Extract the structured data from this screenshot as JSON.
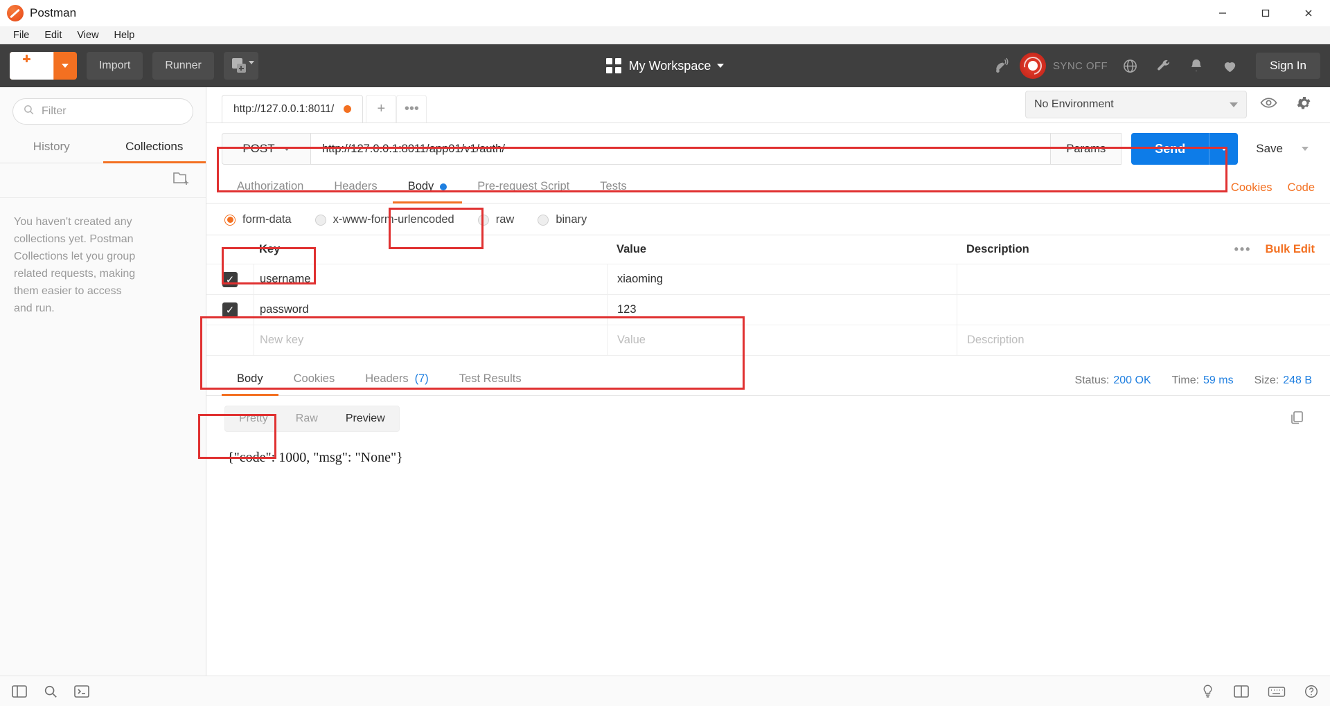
{
  "window": {
    "title": "Postman",
    "logo_icon": "postman-logo-icon",
    "minimize": "—",
    "maximize": "❐",
    "close": "✕"
  },
  "menubar": {
    "items": [
      "File",
      "Edit",
      "View",
      "Help"
    ]
  },
  "header": {
    "new_button": "New",
    "import_button": "Import",
    "runner_button": "Runner",
    "new_window_icon": "new-window-icon",
    "workspace_label": "My Workspace",
    "workspace_icon": "grid-icon",
    "antenna_icon": "satellite-antenna-icon",
    "sync_label": "SYNC OFF",
    "sync_icon": "sync-status-icon",
    "globe_icon": "globe-icon",
    "wrench_icon": "wrench-icon",
    "bell_icon": "bell-icon",
    "heart_icon": "heart-icon",
    "sign_in": "Sign In"
  },
  "sidebar": {
    "filter_placeholder": "Filter",
    "search_icon": "search-icon",
    "tabs": [
      {
        "label": "History",
        "active": false
      },
      {
        "label": "Collections",
        "active": true
      }
    ],
    "new_folder_icon": "new-folder-icon",
    "empty_message": "You haven't created any collections yet. Postman Collections let you group related requests, making them easier to access and run."
  },
  "request_tabs": {
    "open_tab_label": "http://127.0.0.1:8011/",
    "unsaved_indicator": "unsaved-dot",
    "new_tab_icon": "+",
    "more_icon": "•••"
  },
  "environment": {
    "selected": "No Environment",
    "eye_icon": "eye-icon",
    "settings_icon": "gear-icon"
  },
  "url_bar": {
    "method": "POST",
    "url": "http://127.0.0.1:8011/app01/v1/auth/",
    "params_button": "Params",
    "send_button": "Send",
    "save_button": "Save"
  },
  "request_sections": {
    "tabs": [
      {
        "label": "Authorization",
        "active": false,
        "dot": false
      },
      {
        "label": "Headers",
        "active": false,
        "dot": false
      },
      {
        "label": "Body",
        "active": true,
        "dot": true
      },
      {
        "label": "Pre-request Script",
        "active": false,
        "dot": false
      },
      {
        "label": "Tests",
        "active": false,
        "dot": false
      }
    ],
    "cookies_link": "Cookies",
    "code_link": "Code"
  },
  "body_type": {
    "options": [
      {
        "label": "form-data",
        "selected": true
      },
      {
        "label": "x-www-form-urlencoded",
        "selected": false
      },
      {
        "label": "raw",
        "selected": false
      },
      {
        "label": "binary",
        "selected": false
      }
    ]
  },
  "params_table": {
    "columns": [
      "Key",
      "Value",
      "Description"
    ],
    "bulk_edit": "Bulk Edit",
    "more_icon": "•••",
    "rows": [
      {
        "checked": true,
        "key": "username",
        "value": "xiaoming",
        "description": ""
      },
      {
        "checked": true,
        "key": "password",
        "value": "123",
        "description": ""
      }
    ],
    "new_row": {
      "key": "New key",
      "value": "Value",
      "description": "Description"
    }
  },
  "response": {
    "tabs": [
      {
        "label": "Body",
        "active": true,
        "count": ""
      },
      {
        "label": "Cookies",
        "active": false,
        "count": ""
      },
      {
        "label": "Headers",
        "active": false,
        "count": "(7)"
      },
      {
        "label": "Test Results",
        "active": false,
        "count": ""
      }
    ],
    "status_label": "Status:",
    "status_value": "200 OK",
    "time_label": "Time:",
    "time_value": "59 ms",
    "size_label": "Size:",
    "size_value": "248 B",
    "view_modes": [
      {
        "label": "Pretty",
        "active": false
      },
      {
        "label": "Raw",
        "active": false
      },
      {
        "label": "Preview",
        "active": true
      }
    ],
    "copy_icon": "copy-icon",
    "body_text": "{\"code\": 1000, \"msg\": \"None\"}"
  },
  "statusbar": {
    "sidebar_toggle_icon": "sidebar-toggle-icon",
    "find_icon": "search-icon",
    "console_icon": "console-icon",
    "bulb_icon": "lightbulb-icon",
    "layout_icon": "two-pane-icon",
    "keyboard_icon": "keyboard-icon",
    "help_icon": "help-circle-icon"
  },
  "colors": {
    "accent_orange": "#f37021",
    "send_blue": "#0d7ce8",
    "annotation_red": "#e03131",
    "header_dark": "#3f3f3f"
  }
}
